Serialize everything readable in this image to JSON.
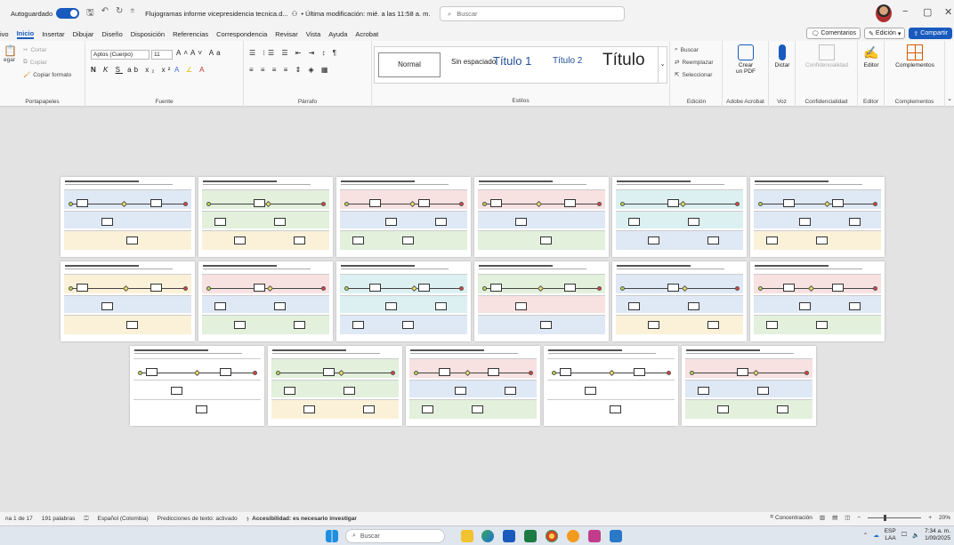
{
  "titlebar": {
    "autosave_label": "Autoguardado",
    "autosave_state": "Sí",
    "document_title": "Flujogramas informe vicepresidencia tecnica.d...",
    "modified": "• Última modificación: mié. a las 11:58 a. m.",
    "search_placeholder": "Buscar",
    "min": "−",
    "max": "▢",
    "close": "✕"
  },
  "menu": {
    "tabs": [
      "ivo",
      "Inicio",
      "Insertar",
      "Dibujar",
      "Diseño",
      "Disposición",
      "Referencias",
      "Correspondencia",
      "Revisar",
      "Vista",
      "Ayuda",
      "Acrobat"
    ],
    "active": "Inicio",
    "comments": "Comentarios",
    "editing": "Edición",
    "share": "Compartir"
  },
  "ribbon": {
    "clipboard": {
      "paste": "egar",
      "cut": "Cortar",
      "copy": "Copiar",
      "format_painter": "Copiar formato",
      "label": "Portapapeles"
    },
    "font": {
      "family": "Aptos (Cuerpo)",
      "size": "11",
      "label": "Fuente"
    },
    "paragraph": {
      "label": "Párrafo"
    },
    "styles": {
      "items": [
        "Normal",
        "Sin espaciado",
        "Título 1",
        "Título 2",
        "Título"
      ],
      "label": "Estilos"
    },
    "editing": {
      "find": "Buscar",
      "replace": "Reemplazar",
      "select": "Seleccionar",
      "label": "Edición"
    },
    "acrobat": {
      "create_pdf_1": "Crear",
      "create_pdf_2": "un PDF",
      "label": "Adobe Acrobat"
    },
    "voice": {
      "dictate": "Dictar",
      "label": "Voz"
    },
    "confidentiality": {
      "button": "Confidencialidad",
      "label": "Confidencialidad"
    },
    "editor": {
      "button": "Editor",
      "label": "Editor"
    },
    "addins": {
      "button": "Complementos",
      "label": "Complementos"
    }
  },
  "pages": [
    {
      "theme": "blue"
    },
    {
      "theme": "green"
    },
    {
      "theme": "pink"
    },
    {
      "theme": "pink"
    },
    {
      "theme": "cyan"
    },
    {
      "theme": "blue"
    },
    {
      "theme": "yellow"
    },
    {
      "theme": "pink"
    },
    {
      "theme": "cyan"
    },
    {
      "theme": "grid"
    },
    {
      "theme": "blue"
    },
    {
      "theme": "pink"
    },
    {
      "theme": "plain"
    },
    {
      "theme": "green"
    },
    {
      "theme": "pink"
    },
    {
      "theme": "plain"
    },
    {
      "theme": "pink"
    }
  ],
  "status": {
    "page": "na 1 de 17",
    "words": "191 palabras",
    "language": "Español (Colombia)",
    "predictions": "Predicciones de texto: activado",
    "accessibility": "Accesibilidad: es necesario investigar",
    "focus": "Concentración",
    "zoom": "20%"
  },
  "taskbar": {
    "search": "Buscar",
    "lang_1": "ESP",
    "lang_2": "LAA",
    "time": "7:34 a. m.",
    "date": "1/09/2025"
  },
  "colors": {
    "accent": "#185abd",
    "lane_blue": "#dfe8f5",
    "lane_green": "#e2f0dc",
    "lane_pink": "#f7e1e1",
    "lane_yellow": "#fbf1d8",
    "lane_cyan": "#dcf0f1"
  }
}
